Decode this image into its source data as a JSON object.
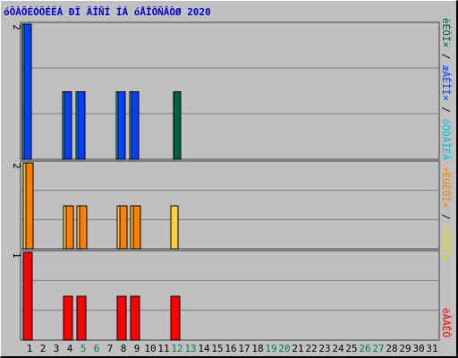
{
  "title": "óÔÀÔÉÓÔÉËÁ ÐÏ ÄÎÑÍ ÍÁ óÅÎÔÑÂÒØ 2020",
  "colors": {
    "background": "#c0c0c0",
    "title": "#0000cc",
    "weekday_label": "#000000",
    "weekend_label": "#008040",
    "grid": "#808080"
  },
  "legends": {
    "panel1": [
      {
        "text": "èÉÔÏ×",
        "color": "#006040"
      },
      {
        "text": " / ",
        "color": "#000000"
      },
      {
        "text": "æÁÊÌÏ×",
        "color": "#0040ff"
      },
      {
        "text": " / ",
        "color": "#000000"
      },
      {
        "text": "óÔÒÁÎÉÃ",
        "color": "#00c0e0"
      }
    ],
    "panel2": [
      {
        "text": "÷ÉÚÉÔÏ×",
        "color": "#ff8000"
      },
      {
        "text": " / ",
        "color": "#000000"
      },
      {
        "text": "èÏÓÔÏ×",
        "color": "#e0e000"
      }
    ],
    "panel3": [
      {
        "text": "ëÂÁÊÔ",
        "color": "#ff0000"
      }
    ]
  },
  "chart_data": {
    "type": "bar",
    "x": [
      1,
      2,
      3,
      4,
      5,
      6,
      7,
      8,
      9,
      10,
      11,
      12,
      13,
      14,
      15,
      16,
      17,
      18,
      19,
      20,
      21,
      22,
      23,
      24,
      25,
      26,
      27,
      28,
      29,
      30,
      31
    ],
    "weekend_days": [
      5,
      6,
      12,
      13,
      19,
      20,
      26,
      27
    ],
    "panels": [
      {
        "ymax": 2,
        "ytick_label": "2",
        "series": [
          {
            "color": "#00c0e0",
            "values": [
              2,
              0,
              0,
              1,
              1,
              0,
              0,
              1,
              1,
              0,
              0,
              0,
              0,
              0,
              0,
              0,
              0,
              0,
              0,
              0,
              0,
              0,
              0,
              0,
              0,
              0,
              0,
              0,
              0,
              0,
              0
            ]
          },
          {
            "color": "#0040ff",
            "values": [
              2,
              0,
              0,
              1,
              1,
              0,
              0,
              1,
              1,
              0,
              0,
              0,
              0,
              0,
              0,
              0,
              0,
              0,
              0,
              0,
              0,
              0,
              0,
              0,
              0,
              0,
              0,
              0,
              0,
              0,
              0
            ]
          },
          {
            "color": "#006040",
            "values": [
              0,
              0,
              0,
              0,
              0,
              0,
              0,
              0,
              0,
              0,
              0,
              1,
              0,
              0,
              0,
              0,
              0,
              0,
              0,
              0,
              0,
              0,
              0,
              0,
              0,
              0,
              0,
              0,
              0,
              0,
              0
            ]
          }
        ]
      },
      {
        "ymax": 2,
        "ytick_label": "2",
        "series": [
          {
            "color": "#ffd040",
            "values": [
              2,
              0,
              0,
              1,
              1,
              0,
              0,
              1,
              1,
              0,
              0,
              1,
              0,
              0,
              0,
              0,
              0,
              0,
              0,
              0,
              0,
              0,
              0,
              0,
              0,
              0,
              0,
              0,
              0,
              0,
              0
            ]
          },
          {
            "color": "#ff8000",
            "values": [
              2,
              0,
              0,
              1,
              1,
              0,
              0,
              1,
              1,
              0,
              0,
              0,
              0,
              0,
              0,
              0,
              0,
              0,
              0,
              0,
              0,
              0,
              0,
              0,
              0,
              0,
              0,
              0,
              0,
              0,
              0
            ]
          }
        ]
      },
      {
        "ymax": 1,
        "ytick_label": "1",
        "series": [
          {
            "color": "#ff0000",
            "values": [
              1,
              0,
              0,
              0.5,
              0.5,
              0,
              0,
              0.5,
              0.5,
              0,
              0,
              0.5,
              0,
              0,
              0,
              0,
              0,
              0,
              0,
              0,
              0,
              0,
              0,
              0,
              0,
              0,
              0,
              0,
              0,
              0,
              0
            ]
          }
        ]
      }
    ]
  }
}
